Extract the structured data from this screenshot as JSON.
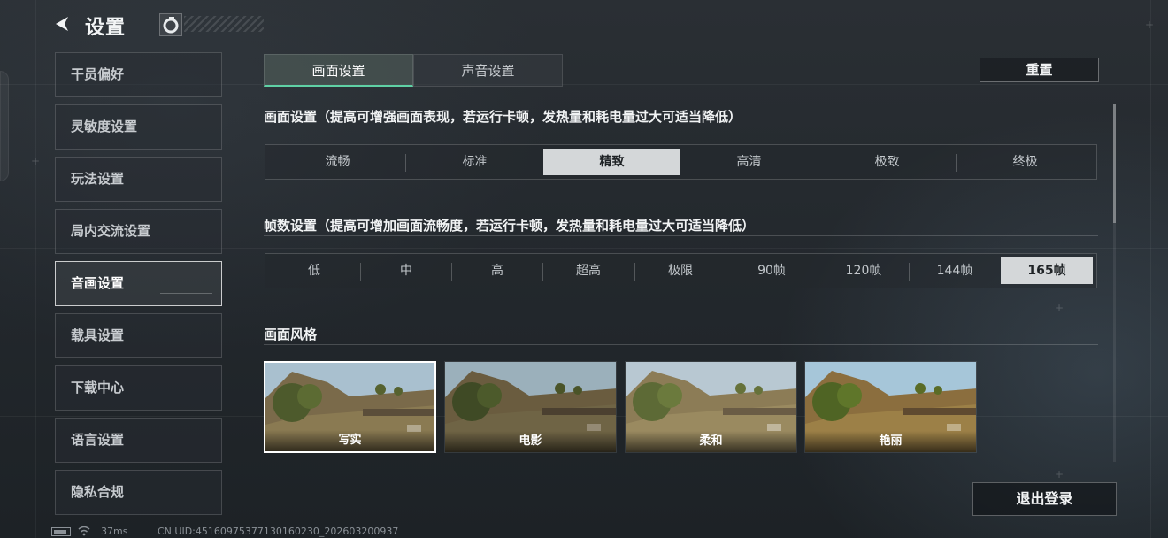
{
  "header": {
    "title": "设置"
  },
  "sidebar": {
    "items": [
      {
        "label": "干员偏好"
      },
      {
        "label": "灵敏度设置"
      },
      {
        "label": "玩法设置"
      },
      {
        "label": "局内交流设置"
      },
      {
        "label": "音画设置",
        "active": true
      },
      {
        "label": "载具设置"
      },
      {
        "label": "下载中心"
      },
      {
        "label": "语言设置"
      },
      {
        "label": "隐私合规"
      }
    ]
  },
  "status_bar": {
    "ping": "37ms",
    "uid": "CN UID:45160975377130160230_202603200937"
  },
  "main": {
    "tabs": [
      {
        "label": "画面设置",
        "active": true
      },
      {
        "label": "声音设置"
      }
    ],
    "reset_label": "重置",
    "quality": {
      "title": "画面设置（提高可增强画面表现，若运行卡顿，发热量和耗电量过大可适当降低）",
      "options": [
        "流畅",
        "标准",
        "精致",
        "高清",
        "极致",
        "终极"
      ],
      "selected": "精致"
    },
    "framerate": {
      "title": "帧数设置（提高可增加画面流畅度，若运行卡顿，发热量和耗电量过大可适当降低）",
      "options": [
        "低",
        "中",
        "高",
        "超高",
        "极限",
        "90帧",
        "120帧",
        "144帧",
        "165帧"
      ],
      "selected": "165帧"
    },
    "style": {
      "title": "画面风格",
      "options": [
        "写实",
        "电影",
        "柔和",
        "艳丽"
      ],
      "selected": "写实"
    },
    "logout_label": "退出登录"
  },
  "colors": {
    "accent": "#5fd1a5",
    "selected_bg": "#d4d7d9",
    "panel_border": "#ffffff"
  },
  "icons": {
    "back": "chevron-left-icon",
    "badge": "grenade-icon",
    "battery": "battery-icon",
    "wifi": "wifi-icon"
  }
}
